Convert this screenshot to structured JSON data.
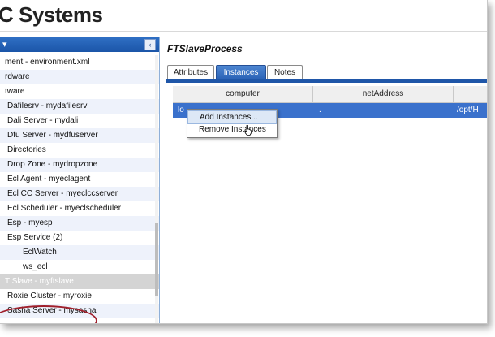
{
  "app": {
    "title": "C Systems"
  },
  "left_panel": {
    "grip_label": "▾",
    "collapse_glyph": "‹",
    "items": [
      {
        "label": "ment - environment.xml",
        "indent": 0
      },
      {
        "label": "rdware",
        "indent": 0
      },
      {
        "label": "tware",
        "indent": 0
      },
      {
        "label": "Dafilesrv - mydafilesrv",
        "indent": 1
      },
      {
        "label": "Dali Server - mydali",
        "indent": 1
      },
      {
        "label": "Dfu Server - mydfuserver",
        "indent": 1
      },
      {
        "label": "Directories",
        "indent": 1
      },
      {
        "label": "Drop Zone - mydropzone",
        "indent": 1
      },
      {
        "label": "Ecl Agent - myeclagent",
        "indent": 1
      },
      {
        "label": "Ecl CC Server - myeclccserver",
        "indent": 1
      },
      {
        "label": "Ecl Scheduler - myeclscheduler",
        "indent": 1
      },
      {
        "label": "Esp - myesp",
        "indent": 1
      },
      {
        "label": "Esp Service (2)",
        "indent": 1
      },
      {
        "label": "EclWatch",
        "indent": 2
      },
      {
        "label": "ws_ecl",
        "indent": 2
      },
      {
        "label": "T Slave - myftslave",
        "indent": 0
      },
      {
        "label": "Roxie Cluster - myroxie",
        "indent": 1
      },
      {
        "label": "Sasha Server - mysasha",
        "indent": 1
      }
    ]
  },
  "right_panel": {
    "title": "FTSlaveProcess",
    "tabs": [
      "Attributes",
      "Instances",
      "Notes"
    ],
    "active_tab": "Instances",
    "grid": {
      "columns": [
        "computer",
        "netAddress",
        ""
      ],
      "rows": [
        {
          "computer": "lo",
          "netAddress": ".",
          "path": "/opt/H"
        }
      ]
    },
    "context_menu": {
      "items": [
        "Add Instances...",
        "Remove Instances"
      ],
      "hovered": "Add Instances..."
    }
  },
  "colors": {
    "accent": "#2a62b6",
    "highlight_ring": "#a0202c",
    "selected_row": "#3a71cc"
  },
  "icons": {
    "cursor": "hand-pointer-icon"
  }
}
